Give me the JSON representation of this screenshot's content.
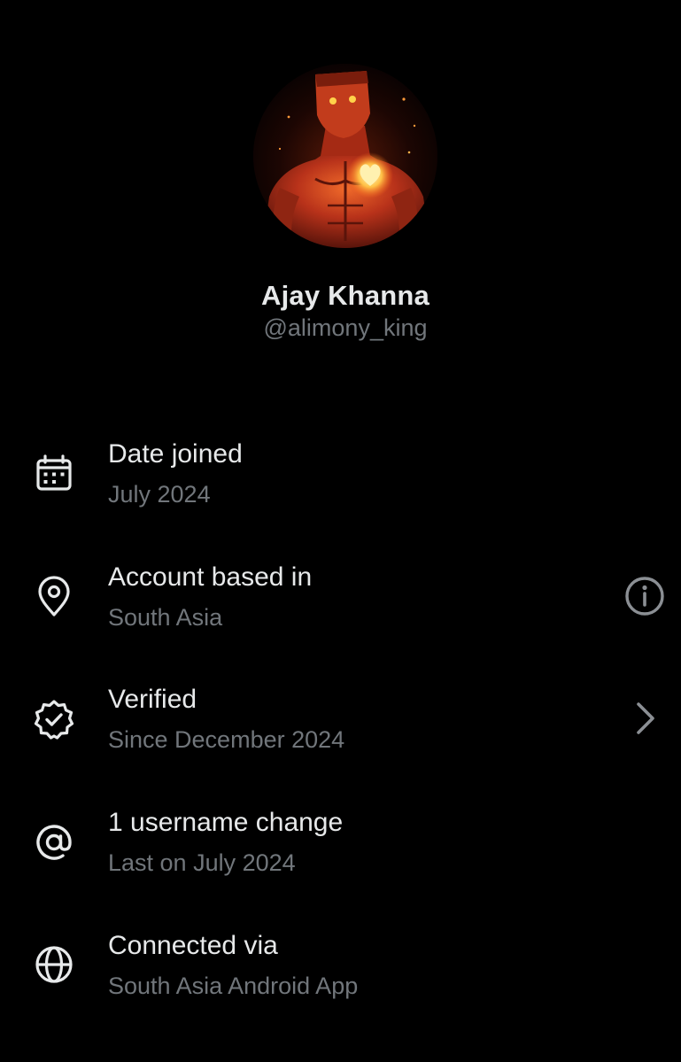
{
  "profile": {
    "name": "Ajay Khanna",
    "handle": "@alimony_king"
  },
  "about_items": [
    {
      "icon": "calendar-icon",
      "title": "Date joined",
      "subtitle": "July 2024"
    },
    {
      "icon": "location-pin-icon",
      "title": "Account based in",
      "subtitle": "South Asia",
      "action_icon": "info-icon"
    },
    {
      "icon": "verified-badge-icon",
      "title": "Verified",
      "subtitle": "Since December 2024",
      "action_icon": "chevron-right-icon"
    },
    {
      "icon": "at-sign-icon",
      "title": "1 username change",
      "subtitle": "Last on July 2024"
    },
    {
      "icon": "globe-icon",
      "title": "Connected via",
      "subtitle": "South Asia Android App"
    }
  ],
  "colors": {
    "background": "#000000",
    "primary_text": "#e7e9ea",
    "secondary_text": "#71767b"
  }
}
